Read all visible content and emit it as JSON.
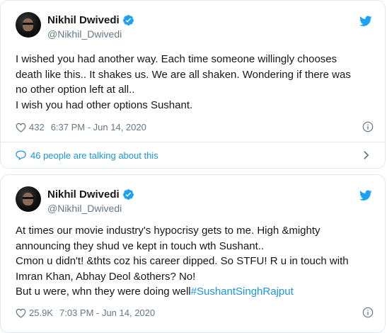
{
  "tweets": [
    {
      "author_name": "Nikhil Dwivedi",
      "author_handle": "@Nikhil_Dwivedi",
      "text_lines": [
        "I wished you had another way. Each time someone willingly chooses",
        "death like this.. It shakes us. We are all shaken. Wondering if there was",
        "no other option left at all..",
        "I wish you had other options Sushant."
      ],
      "likes": "432",
      "timestamp": "6:37 PM - Jun 14, 2020",
      "talking_label": "46 people are talking about this"
    },
    {
      "author_name": "Nikhil Dwivedi",
      "author_handle": "@Nikhil_Dwivedi",
      "text_lines": [
        "At times our movie industry's hypocrisy gets to me. High &mighty",
        "announcing they shud ve kept in touch wth Sushant..",
        "Cmon u didn't! &thts coz his career dipped. So STFU! R u in touch with",
        "Imran Khan, Abhay Deol &others? No!",
        "But u were, whn they were doing well"
      ],
      "hashtag": "#SushantSinghRajput",
      "likes": "25.9K",
      "timestamp": "7:03 PM - Jun 14, 2020"
    }
  ],
  "colors": {
    "twitter_blue": "#1da1f2",
    "link_blue": "#1b95e0",
    "text": "#14171a",
    "muted": "#657786",
    "border": "#e1e8ed"
  },
  "icons": [
    "verified-badge-icon",
    "twitter-bird-icon",
    "heart-icon",
    "info-icon",
    "comment-icon",
    "chevron-right-icon"
  ]
}
